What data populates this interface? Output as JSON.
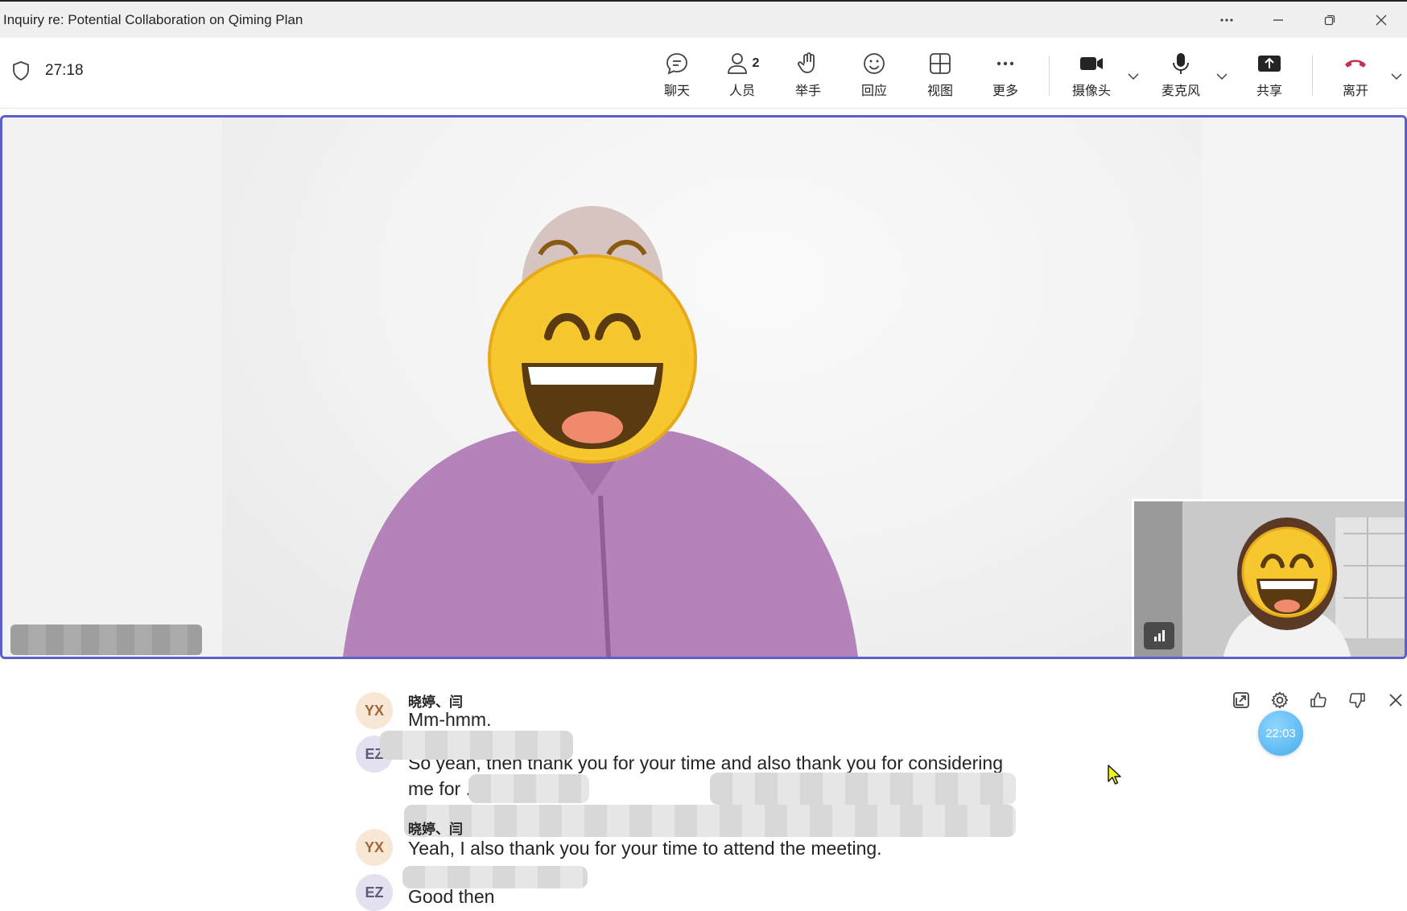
{
  "window": {
    "title": "Inquiry re: Potential Collaboration on Qiming Plan"
  },
  "toolbar": {
    "timer": "27:18",
    "items": [
      {
        "label": "聊天",
        "icon": "chat-icon"
      },
      {
        "label": "人员",
        "icon": "people-icon",
        "badge": "2"
      },
      {
        "label": "举手",
        "icon": "raise-hand-icon"
      },
      {
        "label": "回应",
        "icon": "reaction-icon"
      },
      {
        "label": "视图",
        "icon": "view-icon"
      },
      {
        "label": "更多",
        "icon": "more-icon"
      },
      {
        "label": "摄像头",
        "icon": "camera-icon"
      },
      {
        "label": "麦克风",
        "icon": "microphone-icon"
      },
      {
        "label": "共享",
        "icon": "share-icon"
      },
      {
        "label": "离开",
        "icon": "leave-icon"
      }
    ]
  },
  "captions": {
    "entries": [
      {
        "initials": "YX",
        "speaker": "晓婷、闫",
        "text": "Mm-hmm."
      },
      {
        "initials": "EZ",
        "speaker": "",
        "text": "So yeah, then thank you for your time and also thank you for considering me for ... teresting."
      },
      {
        "initials": "YX",
        "speaker": "晓婷、闫",
        "text": "Yeah, I also thank you for your time to attend the meeting."
      },
      {
        "initials": "EZ",
        "speaker": "",
        "text": "Good then"
      }
    ],
    "timestamp": "22:03"
  },
  "colors": {
    "accent": "#5b5fc7",
    "leave": "#c4314b"
  }
}
